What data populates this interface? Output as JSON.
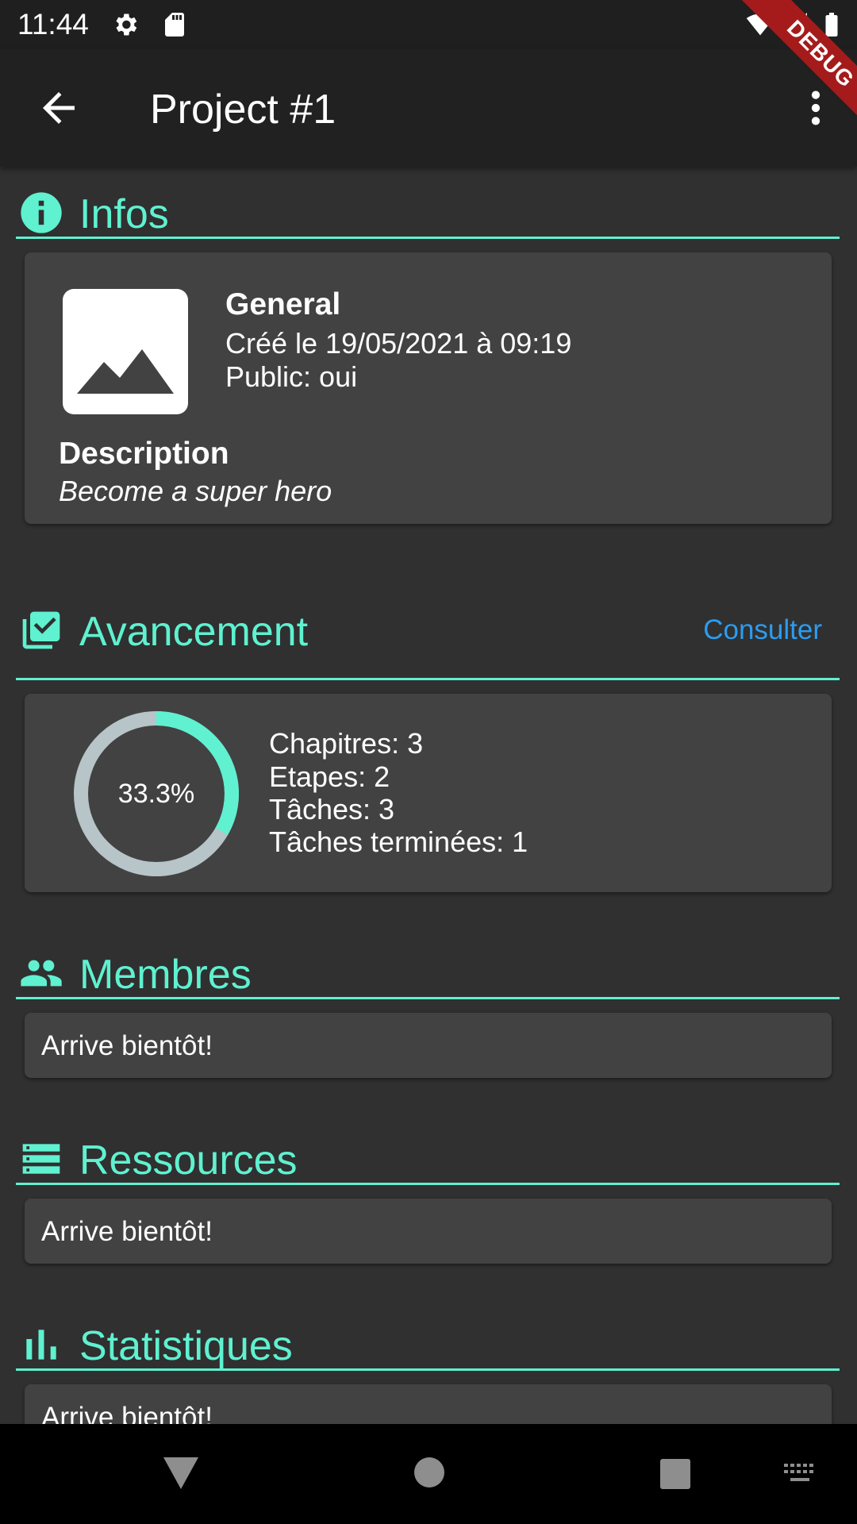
{
  "status": {
    "time": "11:44",
    "icons": [
      "settings-icon",
      "sd-card-icon",
      "wifi-icon",
      "signal-icon",
      "battery-icon"
    ]
  },
  "appbar": {
    "title": "Project #1",
    "debug_label": "DEBUG"
  },
  "infos": {
    "header": "Infos",
    "general_title": "General",
    "created": "Créé le 19/05/2021 à 09:19",
    "public": "Public: oui",
    "description_title": "Description",
    "description_text": "Become a super hero"
  },
  "progress": {
    "header": "Avancement",
    "consult_label": "Consulter",
    "percent_label": "33.3%",
    "percent_value": 0.333,
    "stats": [
      "Chapitres: 3",
      "Etapes: 2",
      "Tâches: 3",
      "Tâches terminées: 1"
    ]
  },
  "members": {
    "header": "Membres",
    "text": "Arrive bientôt!"
  },
  "resources": {
    "header": "Ressources",
    "text": "Arrive bientôt!"
  },
  "stats": {
    "header": "Statistiques",
    "text": "Arrive bientôt!"
  },
  "colors": {
    "accent": "#5ff1d0",
    "link": "#2b9cf0",
    "background": "#303030",
    "card": "#424242",
    "ring_track": "#b7c4c8"
  }
}
